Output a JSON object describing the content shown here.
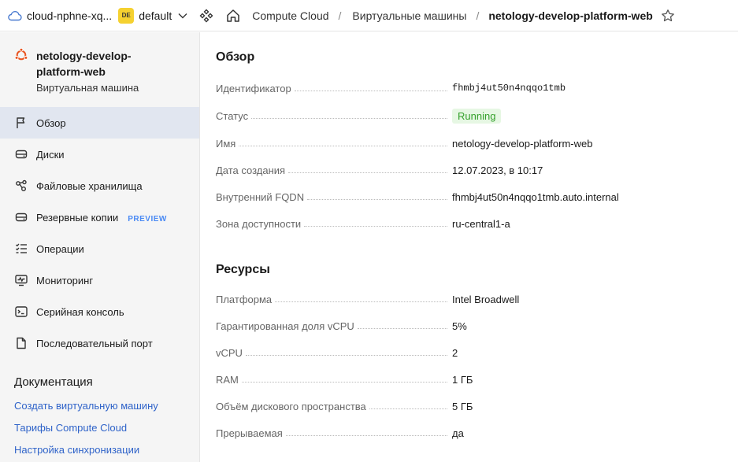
{
  "topbar": {
    "cloud_name": "cloud-nphne-xq...",
    "folder_badge": "DE",
    "folder_name": "default",
    "breadcrumbs": [
      "Compute Cloud",
      "Виртуальные машины"
    ],
    "current": "netology-develop-platform-web"
  },
  "sidebar": {
    "vm_name": "netology-develop-platform-web",
    "vm_type": "Виртуальная машина",
    "items": [
      {
        "label": "Обзор",
        "icon": "flag-icon",
        "active": true
      },
      {
        "label": "Диски",
        "icon": "disk-icon"
      },
      {
        "label": "Файловые хранилища",
        "icon": "share-icon"
      },
      {
        "label": "Резервные копии",
        "icon": "backup-icon",
        "badge": "PREVIEW"
      },
      {
        "label": "Операции",
        "icon": "list-check-icon"
      },
      {
        "label": "Мониторинг",
        "icon": "monitor-icon"
      },
      {
        "label": "Серийная консоль",
        "icon": "console-icon"
      },
      {
        "label": "Последовательный порт",
        "icon": "document-icon"
      }
    ],
    "docs_title": "Документация",
    "docs_links": [
      "Создать виртуальную машину",
      "Тарифы Compute Cloud",
      "Настройка синхронизации"
    ]
  },
  "overview": {
    "title": "Обзор",
    "rows": [
      {
        "key": "Идентификатор",
        "value": "fhmbj4ut50n4nqqo1tmb"
      },
      {
        "key": "Статус",
        "value": "Running"
      },
      {
        "key": "Имя",
        "value": "netology-develop-platform-web"
      },
      {
        "key": "Дата создания",
        "value": "12.07.2023, в 10:17"
      },
      {
        "key": "Внутренний FQDN",
        "value": "fhmbj4ut50n4nqqo1tmb.auto.internal"
      },
      {
        "key": "Зона доступности",
        "value": "ru-central1-a"
      }
    ]
  },
  "resources": {
    "title": "Ресурсы",
    "rows": [
      {
        "key": "Платформа",
        "value": "Intel Broadwell"
      },
      {
        "key": "Гарантированная доля vCPU",
        "value": "5%"
      },
      {
        "key": "vCPU",
        "value": "2"
      },
      {
        "key": "RAM",
        "value": "1 ГБ"
      },
      {
        "key": "Объём дискового пространства",
        "value": "5 ГБ"
      },
      {
        "key": "Прерываемая",
        "value": "да"
      }
    ]
  },
  "colors": {
    "accent": "#2f63c9",
    "status_ok": "#35a12c",
    "active_nav": "#e1e6f0",
    "badge": "#f5d130"
  }
}
